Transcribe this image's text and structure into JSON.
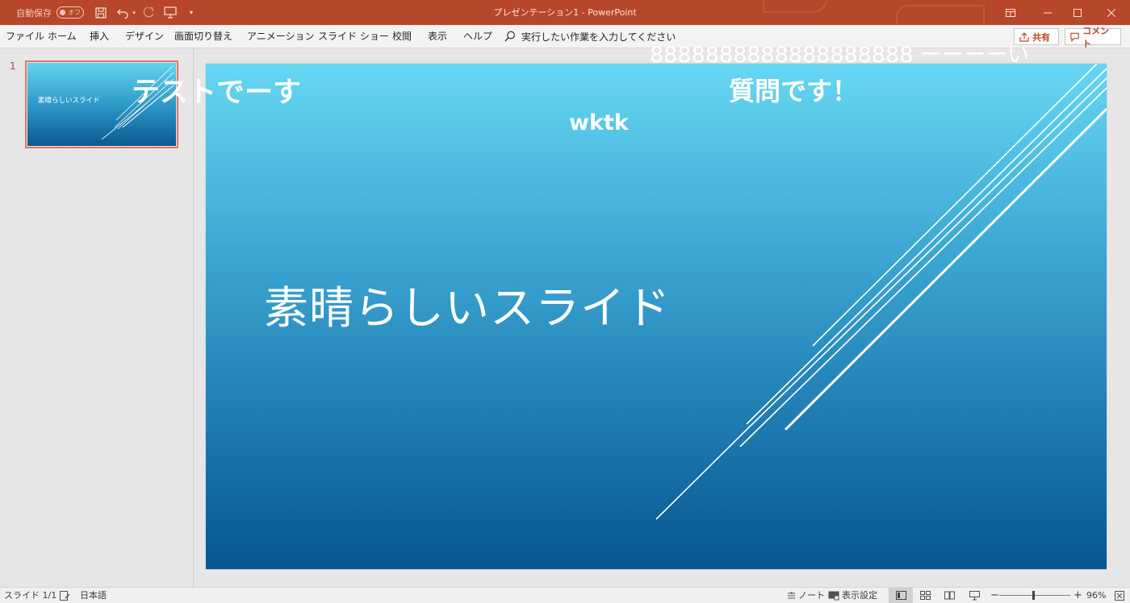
{
  "titlebar": {
    "autosave_label": "自動保存",
    "autosave_state": "オフ",
    "app_title": "プレゼンテーション1  -  PowerPoint",
    "icons": [
      "save-icon",
      "undo-icon",
      "redo-icon",
      "present-from-start-icon",
      "customize-toolbar-icon",
      "ribbon-display-icon",
      "minimize-icon",
      "maximize-icon",
      "close-icon"
    ],
    "color": "#b7472a"
  },
  "ribbon": {
    "tabs": [
      "ファイル",
      "ホーム",
      "挿入",
      "デザイン",
      "画面切り替え",
      "アニメーション",
      "スライド ショー",
      "校閲",
      "表示",
      "ヘルプ"
    ],
    "tell_me": "実行したい作業を入力してください",
    "share": "共有",
    "comments": "コメント"
  },
  "thumbnails": [
    {
      "number": "1",
      "title": "素晴らしいスライド",
      "selected": true
    }
  ],
  "slide": {
    "title": "素晴らしいスライド",
    "wktk": "wktk",
    "overlay_test": "テストでーす",
    "overlay_question": "質問です！",
    "overlay_eights": "8888888888888888888 ーーーーい",
    "gradient": [
      "#66d7f2",
      "#075691"
    ]
  },
  "statusbar": {
    "slide_count": "スライド 1/1",
    "language": "日本語",
    "notes": "ノート",
    "display_settings": "表示設定",
    "zoom_minus": "−",
    "zoom_plus": "+",
    "zoom_level": "96%",
    "zoom_fraction": 0.48
  }
}
